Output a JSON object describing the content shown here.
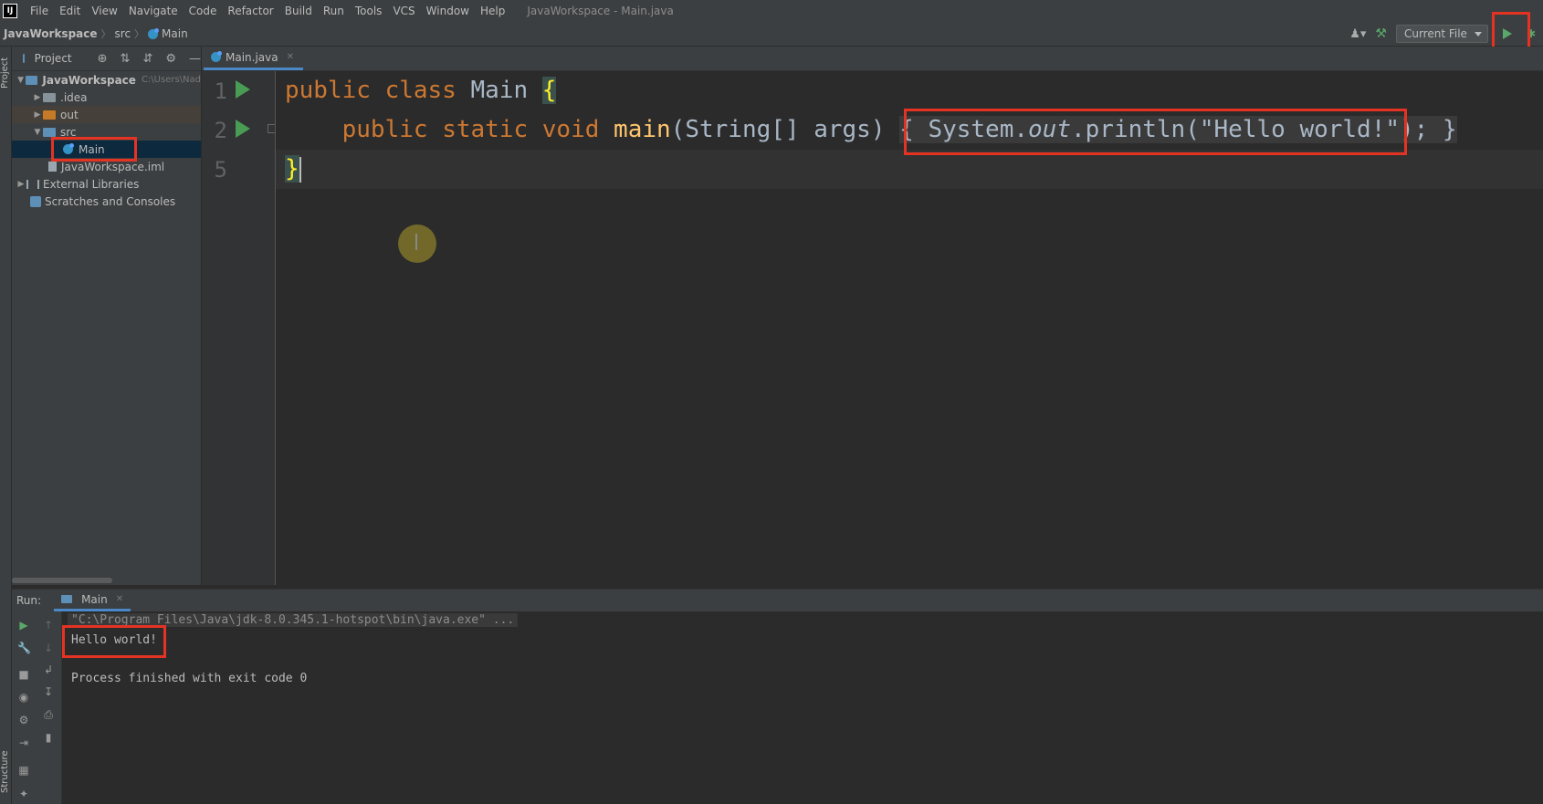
{
  "app": {
    "logo_text": "IJ",
    "window_title": "JavaWorkspace - Main.java"
  },
  "menu": [
    "File",
    "Edit",
    "View",
    "Navigate",
    "Code",
    "Refactor",
    "Build",
    "Run",
    "Tools",
    "VCS",
    "Window",
    "Help"
  ],
  "breadcrumb": {
    "project": "JavaWorkspace",
    "folder": "src",
    "file": "Main"
  },
  "toolbar": {
    "run_config": "Current File"
  },
  "side_strip": {
    "project_label": "Project",
    "structure_label": "Structure"
  },
  "project_panel": {
    "title": "Project",
    "tree": [
      {
        "label": "JavaWorkspace",
        "hint": "C:\\Users\\Nad",
        "level": 0,
        "expanded": true
      },
      {
        "label": ".idea",
        "level": 1,
        "expanded": false
      },
      {
        "label": "out",
        "level": 1,
        "expanded": false
      },
      {
        "label": "src",
        "level": 1,
        "expanded": true
      },
      {
        "label": "Main",
        "level": 2,
        "selected": true
      },
      {
        "label": "JavaWorkspace.iml",
        "level": 1
      },
      {
        "label": "External Libraries",
        "level": 0
      },
      {
        "label": "Scratches and Consoles",
        "level": 0
      }
    ]
  },
  "editor": {
    "tab_label": "Main.java",
    "line_numbers": [
      "1",
      "2",
      "5"
    ],
    "lines": {
      "l1_kw": "public class ",
      "l1_name": "Main ",
      "l1_brace": "{",
      "l2_indent": "    ",
      "l2_kw": "public static void ",
      "l2_fn": "main",
      "l2_params": "(String[] args) ",
      "l2_open": "{ ",
      "l2_sys": "System.",
      "l2_out": "out",
      "l2_print": ".println(",
      "l2_str": "\"Hello world!\"",
      "l2_end": ");",
      "l2_close": " }",
      "l3_brace": "}"
    }
  },
  "run_window": {
    "label": "Run:",
    "tab_label": "Main",
    "command": "\"C:\\Program Files\\Java\\jdk-8.0.345.1-hotspot\\bin\\java.exe\" ...",
    "output": "Hello world!",
    "exit": "Process finished with exit code 0"
  },
  "colors": {
    "highlight_box": "#e53323",
    "run_green": "#59a869",
    "keyword": "#cc7832",
    "string": "#6a8759"
  }
}
